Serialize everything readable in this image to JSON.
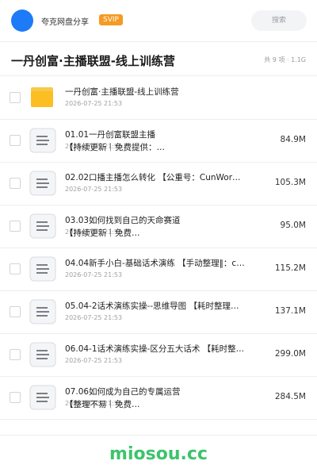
{
  "header": {
    "username": "夸克网盘分享",
    "badge": "SVIP",
    "search_placeholder": "搜索"
  },
  "folder_title": "一丹创富·主播联盟-线上训练营",
  "item_count": "共 9 项 · 1.1G",
  "files": [
    {
      "name": "一丹创富·主播联盟-线上训练营",
      "date": "2026-07-25 21:53",
      "size": "",
      "type": "folder"
    },
    {
      "name": "01.01一丹创富联盟主播",
      "line2": "【持续更新｜免费提供：…",
      "date": "2026-07-25 21:53",
      "size": "84.9M",
      "type": "doc"
    },
    {
      "name": "02.02口播主播怎么转化 【公重号：CunWor…",
      "date": "2026-07-25 21:53",
      "size": "105.3M",
      "type": "doc"
    },
    {
      "name": "03.03如何找到自己的天命赛道",
      "line2": "【持续更新｜免费…",
      "date": "2026-07-25 21:53",
      "size": "95.0M",
      "type": "doc"
    },
    {
      "name": "04.04新手小白-基础话术演练 【手动整理‖：c…",
      "date": "2026-07-25 21:53",
      "size": "115.2M",
      "type": "doc"
    },
    {
      "name": "05.04-2话术演练实操--思维导图 【耗时整理…",
      "date": "2026-07-25 21:53",
      "size": "137.1M",
      "type": "doc"
    },
    {
      "name": "06.04-1话术演练实操-区分五大话术 【耗时整…",
      "date": "2026-07-25 21:53",
      "size": "299.0M",
      "type": "doc"
    },
    {
      "name": "07.06如何成为自己的专属运营",
      "line2": "【整理不易｜免费…",
      "date": "2026-07-25 21:53",
      "size": "284.5M",
      "type": "doc"
    }
  ],
  "watermark": "miosou.cc",
  "colors": {
    "accent": "#1e7bf7",
    "badge": "#f59a23",
    "watermark": "#3cc46a"
  }
}
